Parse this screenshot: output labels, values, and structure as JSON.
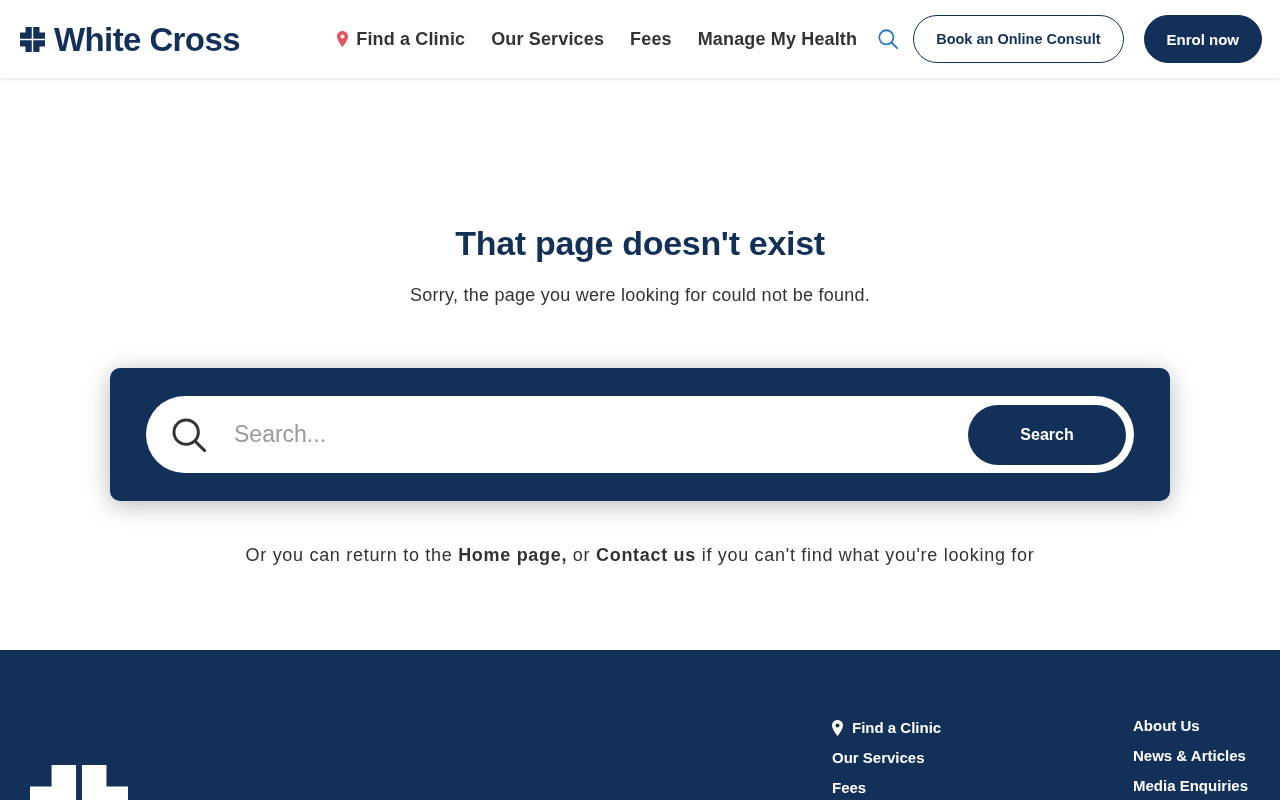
{
  "header": {
    "logo": {
      "text": "White Cross"
    },
    "nav": [
      {
        "label": "Find a Clinic",
        "kind": "location"
      },
      {
        "label": "Our Services",
        "kind": "plain"
      },
      {
        "label": "Fees",
        "kind": "plain"
      },
      {
        "label": "Manage My Health",
        "kind": "plain"
      }
    ],
    "buttons": [
      {
        "label": "Book an Online Consult",
        "kind": "outline"
      },
      {
        "label": "Enrol now",
        "kind": "filled"
      }
    ]
  },
  "main": {
    "title": "That page doesn't exist",
    "message": "Sorry, the page you were looking for could not be found.",
    "search": {
      "placeholder": "Search...",
      "button": "Search"
    },
    "help": [
      {
        "text": "Or you can return to the ",
        "kind": "text"
      },
      {
        "text": "Home page,",
        "kind": "link"
      },
      {
        "text": " or ",
        "kind": "text"
      },
      {
        "text": "Contact us",
        "kind": "link"
      },
      {
        "text": " if you can't find what you're looking for",
        "kind": "text"
      }
    ]
  },
  "footer": {
    "columns": [
      {
        "links": [
          {
            "label": "Find a Clinic",
            "kind": "location"
          },
          {
            "label": "Our Services",
            "kind": "plain"
          },
          {
            "label": "Fees",
            "kind": "plain"
          }
        ]
      },
      {
        "links": [
          {
            "label": "About Us",
            "kind": "plain"
          },
          {
            "label": "News & Articles",
            "kind": "plain"
          },
          {
            "label": "Media Enquiries",
            "kind": "plain"
          }
        ]
      }
    ]
  }
}
